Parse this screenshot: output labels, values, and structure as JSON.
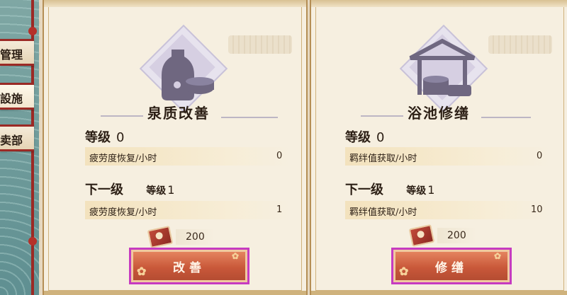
{
  "sidebar": {
    "items": [
      {
        "label": "管理"
      },
      {
        "label": "設施"
      },
      {
        "label": "卖部"
      }
    ]
  },
  "cards": [
    {
      "title": "泉质改善",
      "level_label": "等级",
      "level_value": "0",
      "stat_label": "疲劳度恢复/小时",
      "stat_value": "0",
      "next_label": "下一级",
      "next_level_label": "等级",
      "next_level_value": "1",
      "next_stat_label": "疲劳度恢复/小时",
      "next_stat_value": "1",
      "cost": "200",
      "button_label": "改善",
      "icon": "sake-bottle-icon"
    },
    {
      "title": "浴池修缮",
      "level_label": "等级",
      "level_value": "0",
      "stat_label": "羁绊值获取/小时",
      "stat_value": "0",
      "next_label": "下一级",
      "next_level_label": "等级",
      "next_level_value": "1",
      "next_stat_label": "羁绊值获取/小时",
      "next_stat_value": "10",
      "cost": "200",
      "button_label": "修缮",
      "icon": "well-pavilion-icon"
    }
  ],
  "colors": {
    "accent_red": "#9b2a25",
    "button_orange": "#c9583a",
    "highlight_magenta": "#c63bc0",
    "panel": "#f6efe0"
  }
}
